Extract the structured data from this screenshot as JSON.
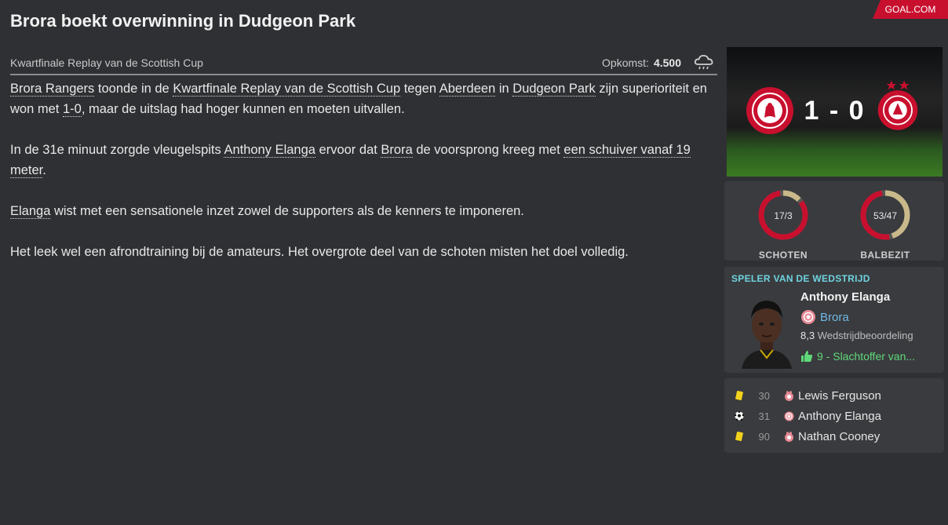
{
  "header": {
    "title": "Brora boekt overwinning in Dudgeon Park",
    "brand": "GOAL.COM"
  },
  "subbar": {
    "competition": "Kwartfinale Replay van de Scottish Cup",
    "attendance_label": "Opkomst:",
    "attendance_value": "4.500",
    "weather_icon": "rain-cloud-icon"
  },
  "article": {
    "p1": [
      {
        "t": "Brora Rangers",
        "link": true
      },
      {
        "t": " toonde in de ",
        "link": false
      },
      {
        "t": "Kwartfinale Replay van de Scottish Cup",
        "link": true
      },
      {
        "t": " tegen ",
        "link": false
      },
      {
        "t": "Aberdeen",
        "link": true
      },
      {
        "t": " in ",
        "link": false
      },
      {
        "t": "Dudgeon Park",
        "link": true
      },
      {
        "t": " zijn superioriteit en won met ",
        "link": false
      },
      {
        "t": "1-0",
        "link": true
      },
      {
        "t": ", maar de uitslag had hoger kunnen en moeten uitvallen.",
        "link": false
      }
    ],
    "p2": [
      {
        "t": "In de 31e minuut zorgde vleugelspits ",
        "link": false
      },
      {
        "t": "Anthony Elanga",
        "link": true
      },
      {
        "t": " ervoor dat ",
        "link": false
      },
      {
        "t": "Brora",
        "link": true
      },
      {
        "t": " de voorsprong kreeg met ",
        "link": false
      },
      {
        "t": "een schuiver vanaf 19 meter",
        "link": true
      },
      {
        "t": ".",
        "link": false
      }
    ],
    "p3": [
      {
        "t": "Elanga",
        "link": true
      },
      {
        "t": " wist met een sensationele inzet zowel de supporters als de kenners te imponeren.",
        "link": false
      }
    ],
    "p4": [
      {
        "t": "Het leek wel een afrondtraining bij de amateurs. Het overgrote deel van de schoten misten het doel volledig.",
        "link": false
      }
    ]
  },
  "score": {
    "text": "1 - 0",
    "home_crest": "brora-rangers-crest-icon",
    "away_crest": "aberdeen-crest-icon"
  },
  "stats": {
    "shots": {
      "label": "SCHOTEN",
      "text": "17/3",
      "home": 17,
      "away": 3
    },
    "possession": {
      "label": "BALBEZIT",
      "text": "53/47",
      "home": 53,
      "away": 47
    },
    "colors": {
      "home": "#c8102e",
      "away": "#c9b98a"
    }
  },
  "motm": {
    "header": "SPELER VAN DE WEDSTRIJD",
    "name": "Anthony Elanga",
    "club": "Brora",
    "rating_value": "8,3",
    "rating_label": "Wedstrijdbeoordeling",
    "trait": "9 - Slachtoffer van...",
    "trait_icon": "thumbs-up-icon"
  },
  "events": [
    {
      "icon": "yellow-card-icon",
      "minute": "30",
      "player": "Lewis Ferguson",
      "team_badge": "aberdeen-badge-icon"
    },
    {
      "icon": "goal-ball-icon",
      "minute": "31",
      "player": "Anthony Elanga",
      "team_badge": "brora-badge-icon"
    },
    {
      "icon": "yellow-card-icon",
      "minute": "90",
      "player": "Nathan Cooney",
      "team_badge": "aberdeen-badge-icon"
    }
  ]
}
